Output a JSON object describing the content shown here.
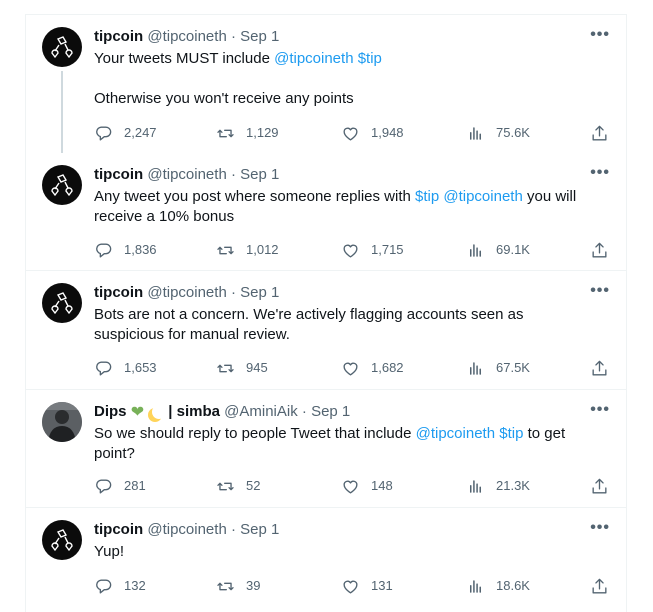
{
  "tweets": [
    {
      "author": "tipcoin",
      "handle": "@tipcoineth",
      "dot": "·",
      "date": "Sep 1",
      "text_lines": [
        [
          {
            "t": "Your tweets MUST include "
          },
          {
            "t": "@tipcoineth",
            "link": true
          },
          {
            "t": " "
          },
          {
            "t": "$tip",
            "link": true
          }
        ],
        [],
        [
          {
            "t": "Otherwise you won't receive any points"
          }
        ]
      ],
      "replies": "2,247",
      "retweets": "1,129",
      "likes": "1,948",
      "views": "75.6K"
    },
    {
      "author": "tipcoin",
      "handle": "@tipcoineth",
      "dot": "·",
      "date": "Sep 1",
      "text_lines": [
        [
          {
            "t": "Any tweet you post where someone replies with "
          },
          {
            "t": "$tip",
            "link": true
          },
          {
            "t": " "
          },
          {
            "t": "@tipcoineth",
            "link": true
          },
          {
            "t": " you will"
          }
        ],
        [
          {
            "t": "receive a 10% bonus"
          }
        ]
      ],
      "replies": "1,836",
      "retweets": "1,012",
      "likes": "1,715",
      "views": "69.1K"
    },
    {
      "author": "tipcoin",
      "handle": "@tipcoineth",
      "dot": "·",
      "date": "Sep 1",
      "text_lines": [
        [
          {
            "t": "Bots are not a concern. We're actively flagging accounts seen as"
          }
        ],
        [
          {
            "t": "suspicious for manual review."
          }
        ]
      ],
      "replies": "1,653",
      "retweets": "945",
      "likes": "1,682",
      "views": "67.5K"
    },
    {
      "author": "Dips",
      "author_suffix": "| simba",
      "handle": "@AminiAik",
      "dot": "·",
      "date": "Sep 1",
      "emojis": [
        "green-heart",
        "crescent-moon"
      ],
      "text_lines": [
        [
          {
            "t": "So we should reply to people Tweet that include "
          },
          {
            "t": "@tipcoineth",
            "link": true
          },
          {
            "t": " "
          },
          {
            "t": "$tip",
            "link": true
          },
          {
            "t": " to get"
          }
        ],
        [
          {
            "t": "point?"
          }
        ]
      ],
      "replies": "281",
      "retweets": "52",
      "likes": "148",
      "views": "21.3K"
    },
    {
      "author": "tipcoin",
      "handle": "@tipcoineth",
      "dot": "·",
      "date": "Sep 1",
      "text_lines": [
        [
          {
            "t": "Yup!"
          }
        ]
      ],
      "replies": "132",
      "retweets": "39",
      "likes": "131",
      "views": "18.6K"
    }
  ],
  "colors": {
    "link": "#1d9bf0",
    "muted": "#536471",
    "text": "#0f1419",
    "thread_line": "#cfd9de",
    "divider": "#eff3f4"
  },
  "icons": [
    "more-icon",
    "reply-icon",
    "retweet-icon",
    "like-icon",
    "views-icon",
    "share-icon"
  ]
}
